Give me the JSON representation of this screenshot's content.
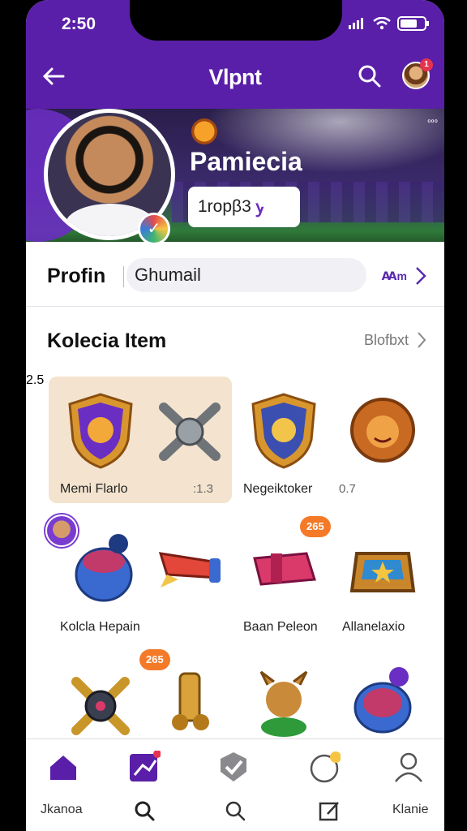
{
  "status_bar": {
    "time": "2:50"
  },
  "app_bar": {
    "title": "Vlpnt"
  },
  "hero": {
    "corner_text": "៰៰៰",
    "name": "Pamiecia",
    "pill_text": "1ropβ3",
    "pill_icon_text": "ꭚ"
  },
  "avatar_badge": "1",
  "profile_row": {
    "label": "Profin",
    "email_value": "Ghumail",
    "right_text": "Ꜳm"
  },
  "section": {
    "title": "Kolecia Item",
    "link": "Blofbxt"
  },
  "items": [
    {
      "label": "Memi Flarlo",
      "value": ":1.3"
    },
    {
      "label": "Negeiktoker",
      "value": "0.7"
    },
    {
      "label": "",
      "value": ""
    },
    {
      "label": "",
      "value": ""
    },
    {
      "label": "Kolcla Hepain",
      "value": "2.5"
    },
    {
      "label": "",
      "value": ""
    },
    {
      "label": "Baan Peleon",
      "value": ""
    },
    {
      "label": "Allanelaxio",
      "value": ""
    }
  ],
  "tags": [
    "265",
    "265"
  ],
  "bottom_nav": {
    "first_label": "Jkanoa",
    "last_label": "Klanie",
    "badges": [
      "1",
      "1"
    ]
  },
  "colors": {
    "brand": "#5a1fa8",
    "accent_orange": "#f47a28",
    "highlight_bg": "#f4e4cf"
  }
}
